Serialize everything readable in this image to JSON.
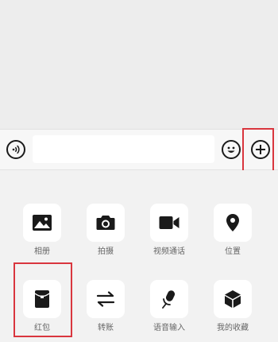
{
  "input_bar": {
    "voice_icon": "voice-wave-icon",
    "text_value": "",
    "emoji_icon": "smiley-icon",
    "plus_icon": "plus-icon"
  },
  "panel": {
    "items": [
      {
        "label": "相册",
        "icon": "image-icon"
      },
      {
        "label": "拍摄",
        "icon": "camera-icon"
      },
      {
        "label": "视频通话",
        "icon": "video-camera-icon"
      },
      {
        "label": "位置",
        "icon": "location-pin-icon"
      },
      {
        "label": "红包",
        "icon": "red-envelope-icon"
      },
      {
        "label": "转账",
        "icon": "transfer-arrows-icon"
      },
      {
        "label": "语音输入",
        "icon": "microphone-icon"
      },
      {
        "label": "我的收藏",
        "icon": "cube-icon"
      }
    ]
  },
  "colors": {
    "highlight": "#d9363e",
    "icon": "#1a1a1a",
    "label": "#666666",
    "panel_background": "#f2f2f2"
  }
}
